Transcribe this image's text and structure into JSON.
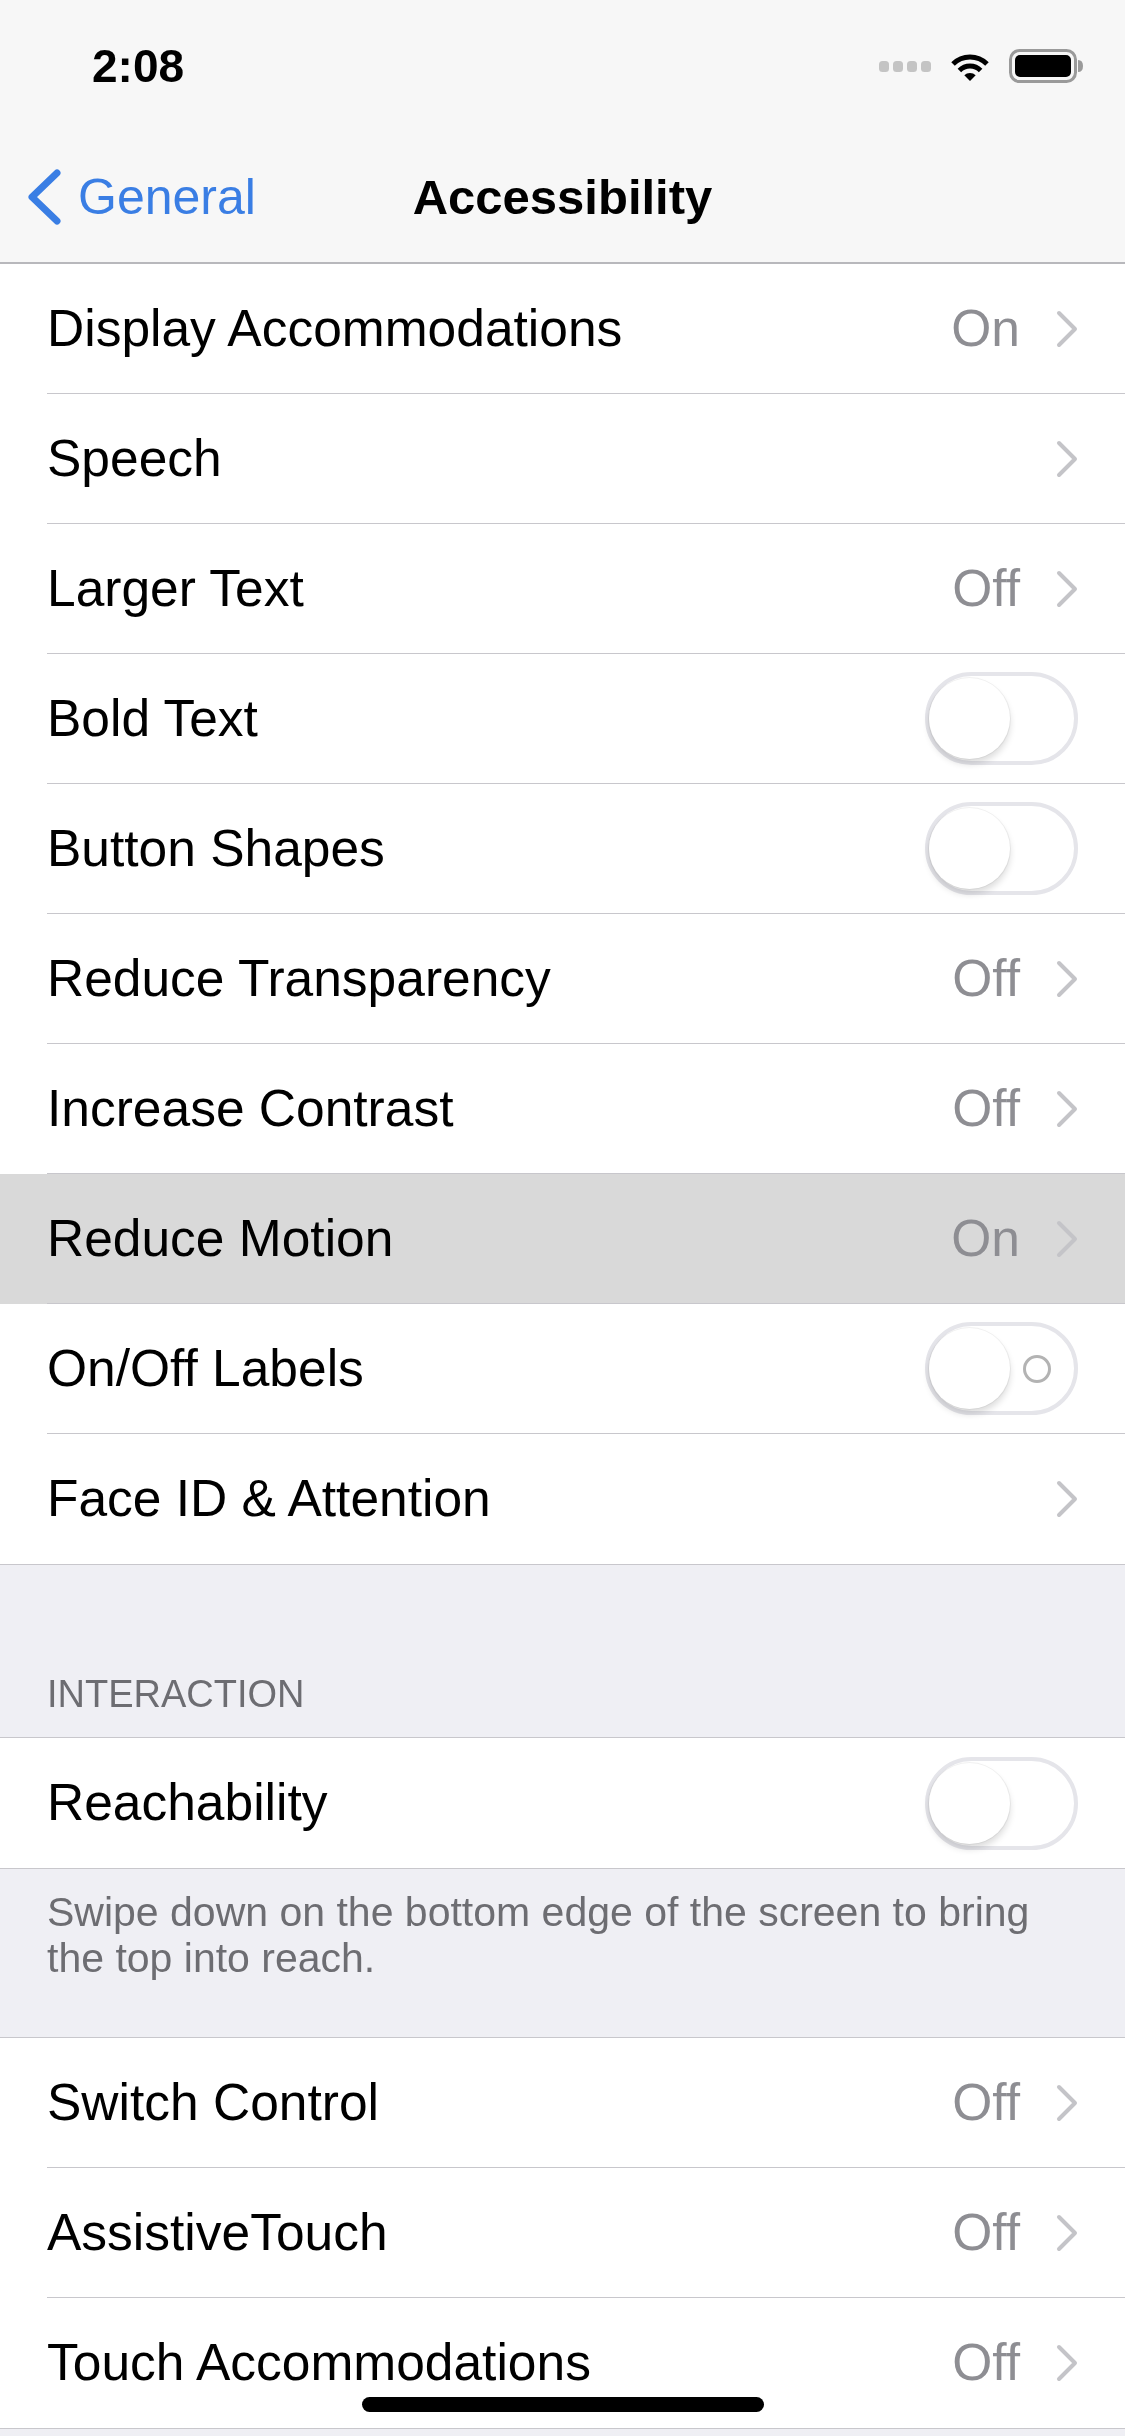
{
  "status_bar": {
    "time": "2:08"
  },
  "nav_bar": {
    "back": "General",
    "title": "Accessibility"
  },
  "groups": [
    {
      "rows": [
        {
          "kind": "link",
          "label": "Display Accommodations",
          "value": "On",
          "selected": false
        },
        {
          "kind": "link",
          "label": "Speech",
          "selected": false
        },
        {
          "kind": "link",
          "label": "Larger Text",
          "value": "Off",
          "selected": false
        },
        {
          "kind": "toggle",
          "label": "Bold Text",
          "on": false,
          "on_off_label": false,
          "selected": false
        },
        {
          "kind": "toggle",
          "label": "Button Shapes",
          "on": false,
          "on_off_label": false,
          "selected": false
        },
        {
          "kind": "link",
          "label": "Reduce Transparency",
          "value": "Off",
          "selected": false
        },
        {
          "kind": "link",
          "label": "Increase Contrast",
          "value": "Off",
          "selected": false
        },
        {
          "kind": "link",
          "label": "Reduce Motion",
          "value": "On",
          "selected": true
        },
        {
          "kind": "toggle",
          "label": "On/Off Labels",
          "on": false,
          "on_off_label": true,
          "selected": false
        },
        {
          "kind": "link",
          "label": "Face ID & Attention",
          "selected": false
        }
      ]
    },
    {
      "header": "INTERACTION",
      "rows": [
        {
          "kind": "toggle",
          "label": "Reachability",
          "on": false,
          "on_off_label": false,
          "selected": false
        }
      ],
      "footer": "Swipe down on the bottom edge of the screen to bring the top into reach."
    },
    {
      "rows": [
        {
          "kind": "link",
          "label": "Switch Control",
          "value": "Off",
          "selected": false
        },
        {
          "kind": "link",
          "label": "AssistiveTouch",
          "value": "Off",
          "selected": false
        },
        {
          "kind": "link",
          "label": "Touch Accommodations",
          "value": "Off",
          "selected": false
        }
      ]
    }
  ]
}
